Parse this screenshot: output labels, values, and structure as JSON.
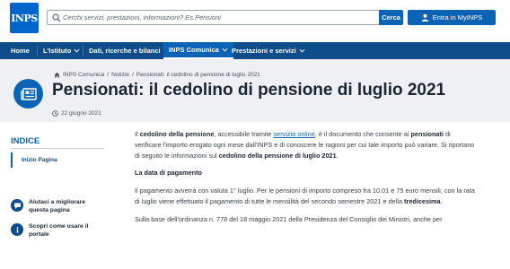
{
  "header": {
    "logo_text": "INPS",
    "search_placeholder": "Cerchi servizi, prestazioni, informazioni? Es.Pensioni",
    "search_button": "Cerca",
    "login_button": "Entra in MyINPS"
  },
  "nav": {
    "items": [
      {
        "label": "Home"
      },
      {
        "label": "L'Istituto"
      },
      {
        "label": "Dati, ricerche e bilanci"
      },
      {
        "label": "INPS Comunica"
      },
      {
        "label": "Prestazioni e servizi"
      }
    ]
  },
  "breadcrumb": {
    "items": [
      "INPS Comunica",
      "Notizie",
      "Pensionati: il cedolino di pensione di luglio 2021"
    ],
    "separator": "/"
  },
  "page": {
    "title": "Pensionati: il cedolino di pensione di luglio 2021",
    "date": "22 giugno 2021"
  },
  "sidebar": {
    "indice_title": "INDICE",
    "indice_item": "Inizio Pagina",
    "links": [
      {
        "label": "Aiutaci a migliorare questa pagina"
      },
      {
        "label": "Scopri come usare il portale"
      }
    ]
  },
  "content": {
    "p1": {
      "t1": "Il ",
      "b1": "cedolino della pensione",
      "t2": ", accessibile tramite ",
      "link": "servizio online",
      "t3": ", è il documento che consente ai ",
      "b2": "pensionati",
      "t4": " di verificare l'importo erogato ogni mese dall'INPS e di conoscere le ragioni per cui tale importo può variare. Si riportano di seguito le informazioni sul ",
      "b3": "cedolino della pensione di luglio 2021",
      "t5": "."
    },
    "subtitle": "La data di pagamento",
    "p2": {
      "t1": "Il pagamento avverrà con valuta 1° luglio. Per le pensioni di importo compreso fra 10,01 e 75 euro mensili, con la rata di luglio viene effettuato il pagamento di tutte le mensilità del secondo semestre 2021 e della ",
      "b1": "tredicesima",
      "t2": "."
    },
    "p3": "Sulla base dell'ordinanza n. 778 del 18 maggio 2021 della Presidenza del Consiglio dei Ministri, anche per"
  }
}
